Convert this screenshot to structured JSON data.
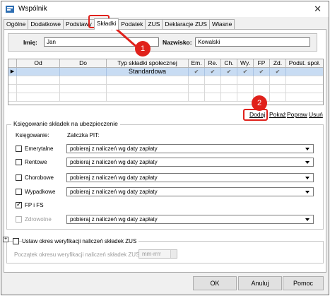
{
  "window": {
    "title": "Wspólnik",
    "close_symbol": "✕"
  },
  "tabs": [
    "Ogólne",
    "Dodatkowe",
    "Podstawy",
    "Składki",
    "Podatek",
    "ZUS",
    "Deklaracje ZUS",
    "Własne"
  ],
  "active_tab": "Składki",
  "person": {
    "first_name_label": "Imię:",
    "first_name_value": "Jan",
    "last_name_label": "Nazwisko:",
    "last_name_value": "Kowalski"
  },
  "grid": {
    "columns": [
      "Od",
      "Do",
      "Typ składki społecznej",
      "Em.",
      "Re.",
      "Ch.",
      "Wy.",
      "FP",
      "Zd.",
      "Podst. społ."
    ],
    "rows": [
      {
        "od": "",
        "do": "",
        "typ": "Standardowa",
        "checks": [
          "✔",
          "✔",
          "✔",
          "✔",
          "✔",
          "✔"
        ],
        "podst": "",
        "row_marker": "▶"
      }
    ]
  },
  "grid_actions": {
    "add": "Dodaj",
    "show": "Pokaż",
    "edit": "Popraw",
    "delete": "Usuń"
  },
  "ksiegowanie": {
    "group_title": "Księgowanie składek na ubezpieczenie",
    "col1_header": "Księgowanie:",
    "col2_header": "Zaliczka PIT:",
    "items": [
      {
        "label": "Emerytalne",
        "checked": false,
        "disabled": false,
        "option": "pobieraj z naliczeń wg daty zapłaty"
      },
      {
        "label": "Rentowe",
        "checked": false,
        "disabled": false,
        "option": "pobieraj z naliczeń wg daty zapłaty"
      },
      {
        "label": "Chorobowe",
        "checked": false,
        "disabled": false,
        "option": "pobieraj z naliczeń wg daty zapłaty"
      },
      {
        "label": "Wypadkowe",
        "checked": false,
        "disabled": false,
        "option": "pobieraj z naliczeń wg daty zapłaty"
      },
      {
        "label": "FP i FS",
        "checked": true,
        "disabled": false,
        "option": ""
      },
      {
        "label": "Zdrowotne",
        "checked": false,
        "disabled": true,
        "option": "pobieraj z naliczeń wg daty zapłaty"
      }
    ]
  },
  "weryfikacja": {
    "expander": "+",
    "title": "Ustaw okres weryfikacji naliczeń składek ZUS",
    "start_label": "Początek okresu weryfikacji naliczeń składek ZUS:",
    "start_placeholder": "mm-rrrr"
  },
  "buttons": {
    "ok": "OK",
    "cancel": "Anuluj",
    "help": "Pomoc"
  },
  "annotations": {
    "badge1": "1",
    "badge2": "2"
  },
  "colors": {
    "annotation_red": "#e0211b",
    "selected_row": "#c8dcf3"
  }
}
